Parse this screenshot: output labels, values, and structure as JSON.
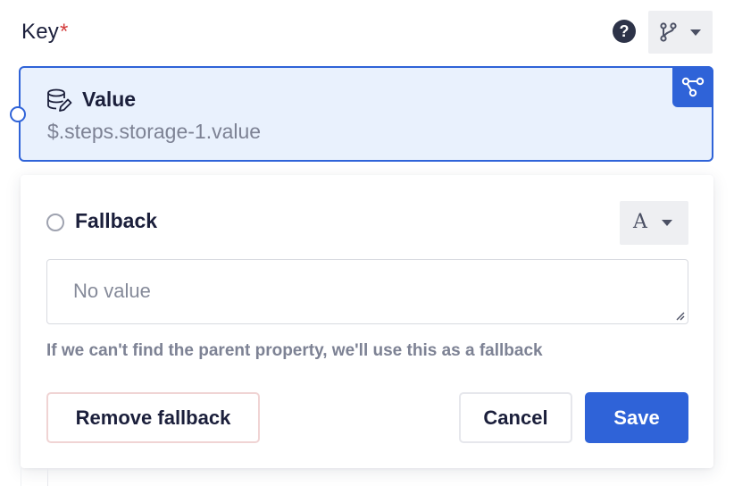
{
  "field": {
    "label": "Key",
    "required_mark": "*"
  },
  "header": {
    "help_icon": "question-circle-icon",
    "branch_icon": "git-branch-icon",
    "dropdown_icon": "caret-down-icon"
  },
  "value_card": {
    "icon": "database-edit-icon",
    "title": "Value",
    "path": "$.steps.storage-1.value",
    "connect_icon": "connect-nodes-icon",
    "accent_color": "#2f63d8",
    "background_color": "#e9f1fd"
  },
  "fallback": {
    "title": "Fallback",
    "type_glyph": "A",
    "input_placeholder": "No value",
    "hint": "If we can't find the parent property, we'll use this as a fallback",
    "remove_label": "Remove fallback",
    "cancel_label": "Cancel",
    "save_label": "Save",
    "save_color": "#2f63d8"
  }
}
